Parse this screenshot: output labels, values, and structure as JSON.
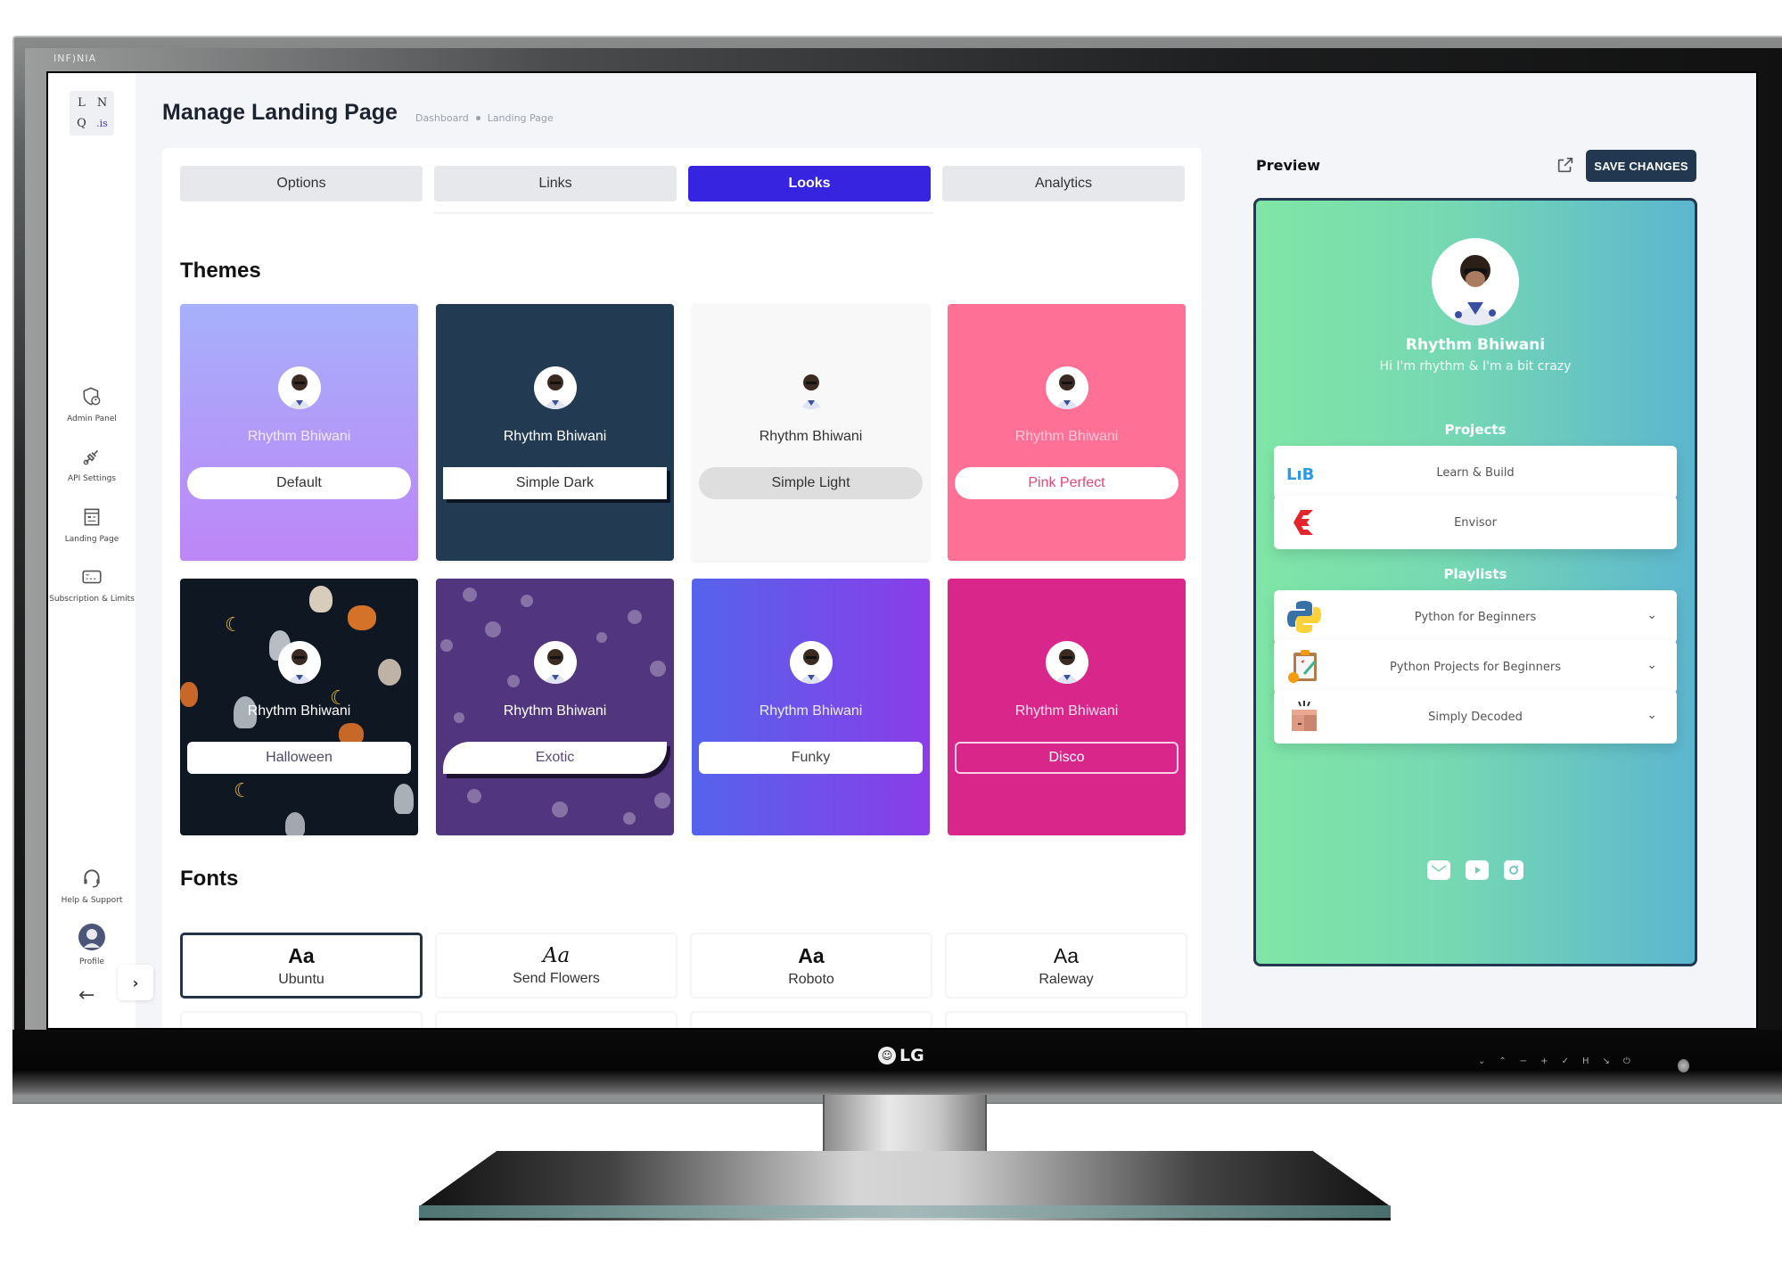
{
  "device": {
    "bezel_brand": "INF)NIA",
    "monitor_brand": "LG",
    "front_buttons": [
      "⌄",
      "⌃",
      "−",
      "+",
      "✓",
      "H",
      "↘",
      "⏻"
    ]
  },
  "sidebar": {
    "logo": {
      "tl": "L",
      "tr": "N",
      "bl": "Q",
      "br": ".is"
    },
    "items": [
      {
        "label": "Admin Panel",
        "icon": "shield-user-icon"
      },
      {
        "label": "API Settings",
        "icon": "plug-icon"
      },
      {
        "label": "Landing Page",
        "icon": "landing-page-icon"
      },
      {
        "label": "Subscription & Limits",
        "icon": "card-icon"
      }
    ],
    "bottom_items": [
      {
        "label": "Help & Support",
        "icon": "headset-icon"
      },
      {
        "label": "Profile",
        "icon": "avatar-icon"
      }
    ],
    "expand_label": "›",
    "back_label": "←"
  },
  "header": {
    "title": "Manage Landing Page",
    "breadcrumb": [
      "Dashboard",
      "Landing Page"
    ]
  },
  "tabs": [
    {
      "label": "Options",
      "active": false
    },
    {
      "label": "Links",
      "active": false
    },
    {
      "label": "Looks",
      "active": true
    },
    {
      "label": "Analytics",
      "active": false
    }
  ],
  "themes": {
    "title": "Themes",
    "profile_name": "Rhythm Bhiwani",
    "items": [
      {
        "label": "Default"
      },
      {
        "label": "Simple Dark"
      },
      {
        "label": "Simple Light"
      },
      {
        "label": "Pink Perfect"
      },
      {
        "label": "Halloween"
      },
      {
        "label": "Exotic"
      },
      {
        "label": "Funky"
      },
      {
        "label": "Disco"
      }
    ]
  },
  "fonts": {
    "title": "Fonts",
    "sample": "Aa",
    "items": [
      {
        "label": "Ubuntu",
        "selected": true
      },
      {
        "label": "Send Flowers",
        "selected": false
      },
      {
        "label": "Roboto",
        "selected": false
      },
      {
        "label": "Raleway",
        "selected": false
      },
      {
        "label": "",
        "selected": false
      },
      {
        "label": "",
        "selected": false
      },
      {
        "label": "",
        "selected": false
      },
      {
        "label": "",
        "selected": false
      }
    ]
  },
  "preview": {
    "label": "Preview",
    "save_label": "SAVE CHANGES",
    "name": "Rhythm Bhiwani",
    "bio": "Hi I'm rhythm & I'm a bit crazy",
    "projects_title": "Projects",
    "projects": [
      {
        "label": "Learn & Build",
        "icon": "lib-logo-icon"
      },
      {
        "label": "Envisor",
        "icon": "envisor-logo-icon"
      }
    ],
    "playlists_title": "Playlists",
    "playlists": [
      {
        "label": "Python for Beginners",
        "icon": "python-logo-icon"
      },
      {
        "label": "Python Projects for Beginners",
        "icon": "clipboard-icon"
      },
      {
        "label": "Simply Decoded",
        "icon": "box-icon"
      }
    ],
    "socials": [
      "mail-icon",
      "youtube-icon",
      "instagram-icon"
    ],
    "colors": {
      "accent": "#3624e0",
      "save_bg": "#213850",
      "gradient_start": "#80e6a6",
      "gradient_end": "#5cb6cf"
    }
  }
}
